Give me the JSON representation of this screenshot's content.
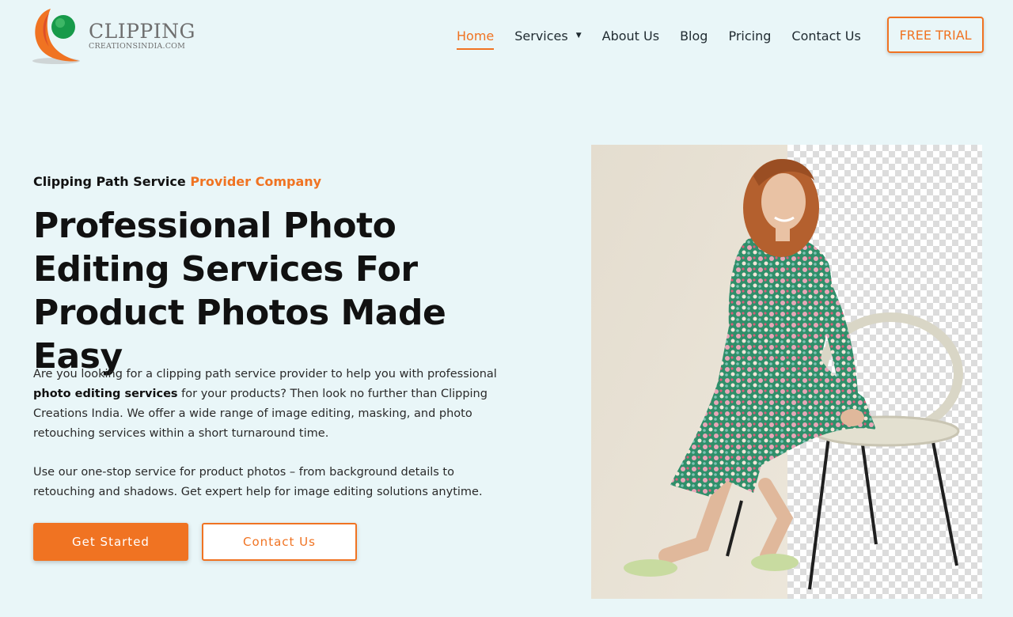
{
  "logo": {
    "main": "CLIPPING",
    "sub": "CREATIONSINDIA.COM",
    "icon": "clipping-logo-mark"
  },
  "nav": {
    "items": [
      {
        "label": "Home",
        "active": true
      },
      {
        "label": "Services",
        "has_dropdown": true
      },
      {
        "label": "About Us"
      },
      {
        "label": "Blog"
      },
      {
        "label": "Pricing"
      },
      {
        "label": "Contact Us"
      }
    ],
    "cta": "FREE TRIAL"
  },
  "hero": {
    "eyebrow_plain": "Clipping Path Service",
    "eyebrow_accent": "Provider Company",
    "title": "Professional Photo Editing Services For Product Photos Made Easy",
    "para1_a": "Are you looking for a clipping path service provider to help you with professional",
    "para1_bold": "photo editing services",
    "para1_b": "for your products? Then look no further than Clipping Creations India. We offer a wide range of image editing, masking, and photo retouching services within a short turnaround time.",
    "para2": "Use our one-stop service for product photos – from background details to retouching and shadows. Get expert help for image editing solutions anytime.",
    "primary_button": "Get Started",
    "secondary_button": "Contact Us"
  },
  "colors": {
    "accent": "#f07322",
    "background": "#e9f6f8",
    "text": "#111111"
  }
}
